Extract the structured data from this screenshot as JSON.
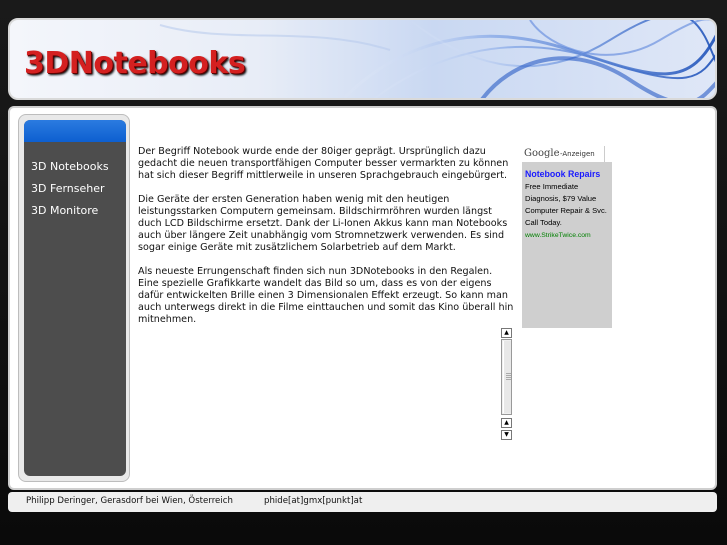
{
  "header": {
    "logo": "3DNotebooks"
  },
  "sidebar": {
    "items": [
      {
        "label": "3D Notebooks"
      },
      {
        "label": "3D Fernseher"
      },
      {
        "label": "3D Monitore"
      }
    ]
  },
  "article": {
    "paragraphs": [
      "Der Begriff Notebook wurde ende der 80iger geprägt. Ursprünglich dazu gedacht die neuen transportfähigen Computer besser vermarkten zu können hat sich dieser Begriff mittlerweile in unseren Sprachgebrauch eingebürgert.",
      "Die Geräte der ersten Generation haben wenig mit den heutigen leistungsstarken Computern gemeinsam. Bildschirmröhren wurden längst duch LCD Bildschirme ersetzt. Dank der Li-Ionen Akkus kann man Notebooks auch über längere Zeit unabhängig vom Stromnetzwerk verwenden. Es sind sogar einige Geräte mit zusätzlichem Solarbetrieb auf dem Markt.",
      "Als neueste Errungenschaft finden sich nun 3DNotebooks in den Regalen. Eine spezielle Grafikkarte wandelt das Bild so um, dass es von der eigens dafür entwickelten Brille einen 3 Dimensionalen Effekt erzeugt. So kann man auch unterwegs direkt in die Filme einttauchen und somit das Kino überall hin mitnehmen."
    ]
  },
  "ad": {
    "brand": "Google",
    "label": "-Anzeigen",
    "title": "Notebook Repairs",
    "body": "Free Immediate Diagnosis, $79 Value Computer Repair & Svc. Call Today.",
    "url": "www.StrikeTwice.com"
  },
  "footer": {
    "address": "Philipp Deringer, Gerasdorf bei Wien, Österreich",
    "email": "phide[at]gmx[punkt]at"
  },
  "colors": {
    "logo": "#d42020",
    "sidebar_bg": "#4d4d4d",
    "sidebar_accent": "#0d5fd0",
    "ad_title": "#1a1aff",
    "ad_url": "#008000"
  }
}
